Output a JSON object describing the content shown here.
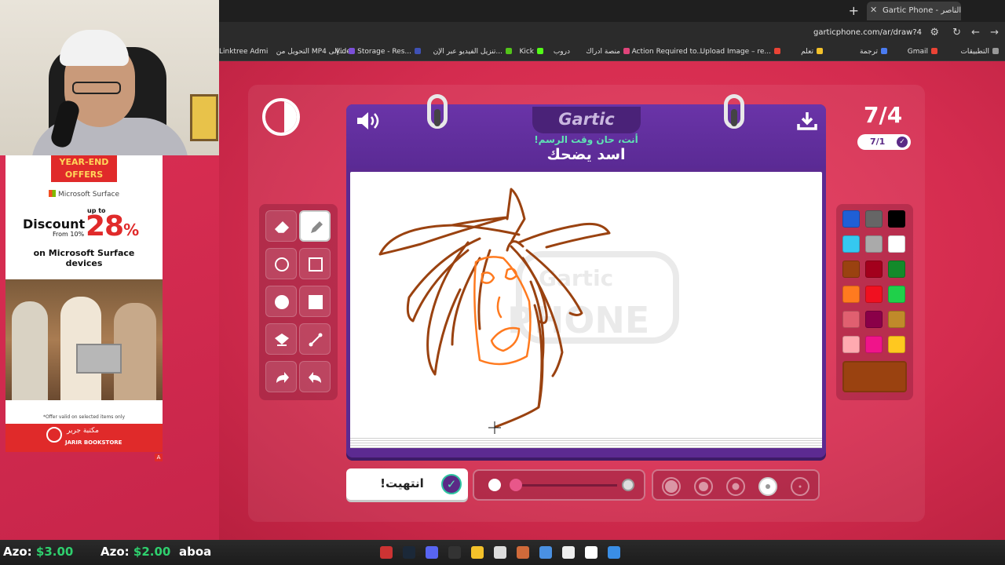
{
  "browser": {
    "tab_title": "Gartic Phone - أحمد الناصر",
    "url": "garticphone.com/ar/draw?4",
    "bookmarks": [
      "التطبيقات",
      "Gmail",
      "ترجمة",
      "تعلم",
      "Upload Image – re...",
      "Action Required to...",
      "منصة ادراك",
      "دروب",
      "Kick",
      "تنزيل الفيديو عبر الإن...",
      "Video Storage - Res...",
      "التحويل من MP4 إلى...",
      "Linktree Admin"
    ]
  },
  "ad": {
    "ribbon": "YEAR-END\nOFFERS",
    "brand": "Microsoft Surface",
    "discount": "Discount",
    "from": "From 10%",
    "upto": "up to",
    "percent": "28",
    "percent_sign": "%",
    "on_line1": "on Microsoft Surface",
    "on_line2": "devices",
    "note": "*Offer valid on selected items only",
    "store_ar": "مكتبة جرير",
    "store_en": "JARIR BOOKSTORE",
    "badge": "A"
  },
  "game": {
    "logo": "Gartic",
    "prompt_sub": "أنت، حان وقت الرسم!",
    "prompt_main": "اسد يضحك",
    "round_big": "7/4",
    "round_pill": "7/1",
    "done_label": "انتهيت!",
    "current_color": "#9a4210",
    "palette": [
      "#1f5fd6",
      "#666666",
      "#000000",
      "#35c8f0",
      "#aaaaaa",
      "#ffffff",
      "#9a4210",
      "#a3001c",
      "#138a2a",
      "#ff7a1f",
      "#f01020",
      "#1fd04a",
      "#e06070",
      "#8a0048",
      "#c08a2a",
      "#ffaab0",
      "#f0148a",
      "#ffc81f"
    ],
    "tools": [
      "eraser-icon",
      "pencil-icon",
      "circle-outline-icon",
      "square-outline-icon",
      "circle-fill-icon",
      "square-fill-icon",
      "bucket-icon",
      "line-icon",
      "redo-icon",
      "undo-icon"
    ],
    "opacity": 0.0,
    "brush_sizes": 5,
    "selected_brush_size": 4
  },
  "overlay": {
    "t1_name": "Azo:",
    "t1_amount": "$3.00",
    "t2_name": "Azo:",
    "t2_amount": "$2.00",
    "t3": "aboa"
  },
  "taskbar_icons": [
    "obs-icon",
    "steam-icon",
    "discord-icon",
    "voicemeeter-icon",
    "folder-icon",
    "store-icon",
    "app-icon",
    "chrome-icon",
    "window-icon",
    "search-icon",
    "start-icon"
  ]
}
